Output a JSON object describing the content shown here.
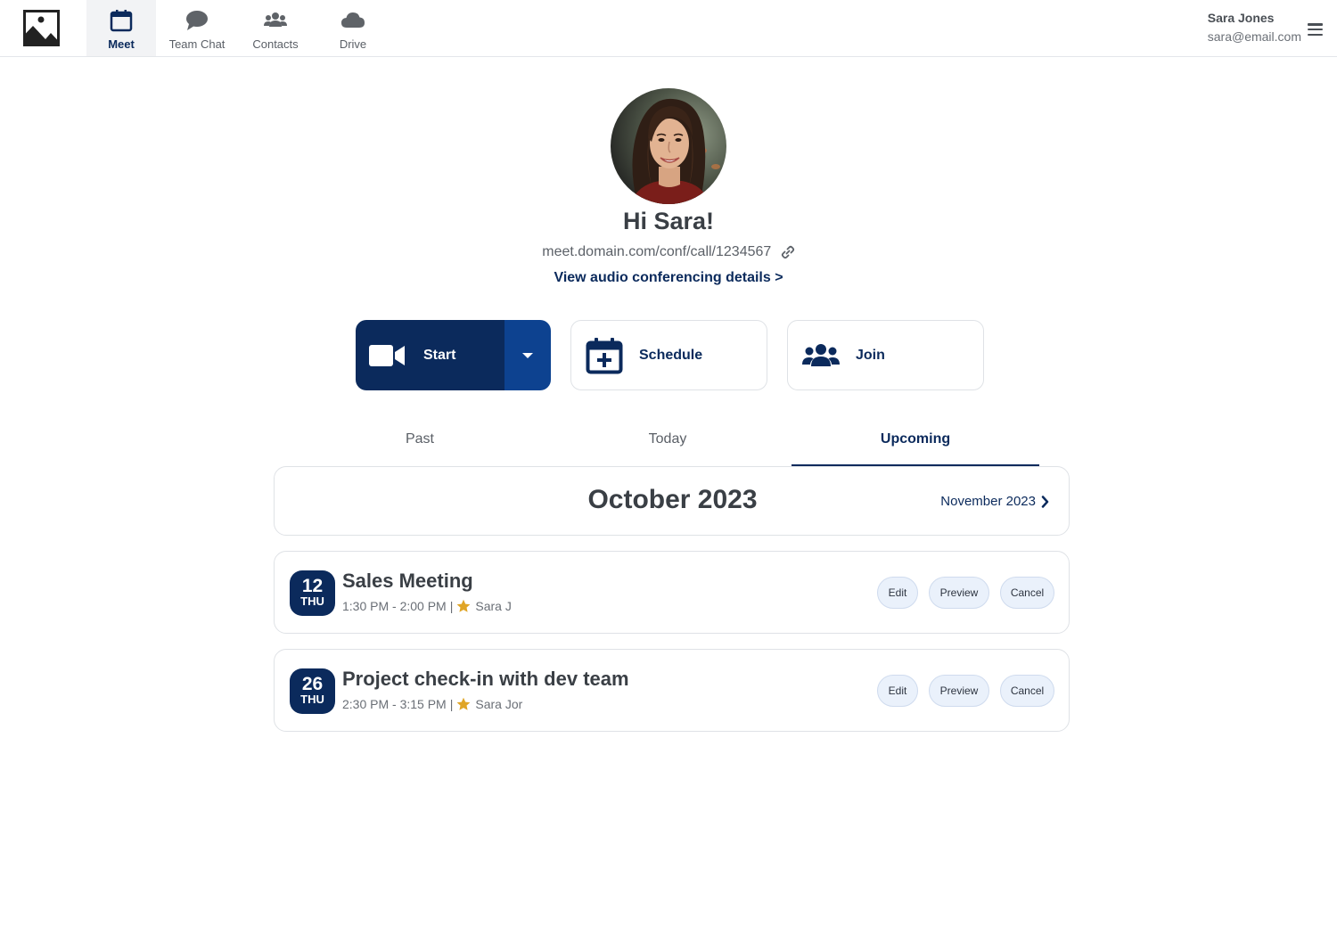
{
  "nav": {
    "items": [
      {
        "label": "Meet",
        "icon": "calendar-icon",
        "active": true
      },
      {
        "label": "Team Chat",
        "icon": "chat-bubble-icon"
      },
      {
        "label": "Contacts",
        "icon": "people-icon"
      },
      {
        "label": "Drive",
        "icon": "cloud-icon"
      }
    ]
  },
  "user": {
    "name": "Sara Jones",
    "email": "sara@email.com"
  },
  "profile": {
    "greeting": "Hi Sara!",
    "meeting_link": "meet.domain.com/conf/call/1234567",
    "audio_details_link": "View audio conferencing details >"
  },
  "actions": {
    "start_label": "Start",
    "schedule_label": "Schedule",
    "join_label": "Join"
  },
  "tabs": [
    {
      "label": "Past"
    },
    {
      "label": "Today"
    },
    {
      "label": "Upcoming",
      "active": true
    }
  ],
  "month": {
    "current": "October 2023",
    "next": "November 2023"
  },
  "meetings": [
    {
      "day": "12",
      "dow": "THU",
      "title": "Sales Meeting",
      "time": "1:30 PM - 2:00 PM",
      "host": "Sara J",
      "buttons": {
        "edit": "Edit",
        "preview": "Preview",
        "cancel": "Cancel"
      }
    },
    {
      "day": "26",
      "dow": "THU",
      "title": "Project check-in with dev team",
      "time": "2:30 PM - 3:15 PM",
      "host": "Sara Jor",
      "buttons": {
        "edit": "Edit",
        "preview": "Preview",
        "cancel": "Cancel"
      }
    }
  ],
  "colors": {
    "primary": "#0b2a5c",
    "primary_light": "#0d4290",
    "star": "#e0a526",
    "pill_bg": "#eaf1fb"
  },
  "separator": "|"
}
